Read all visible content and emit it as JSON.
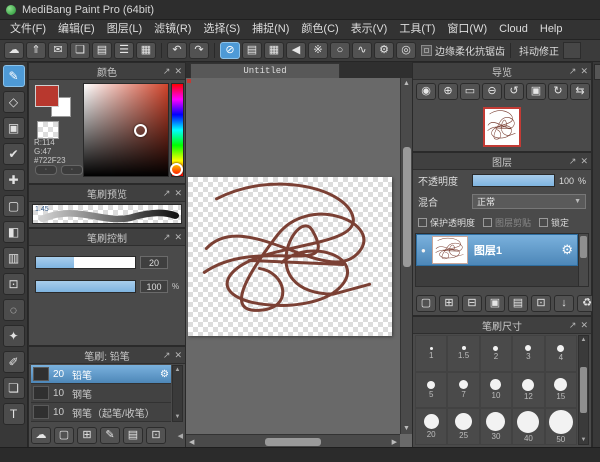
{
  "window": {
    "title": "MediBang Paint Pro (64bit)"
  },
  "menu": {
    "items": [
      "文件(F)",
      "编辑(E)",
      "图层(L)",
      "滤镜(R)",
      "选择(S)",
      "捕捉(N)",
      "颜色(C)",
      "表示(V)",
      "工具(T)",
      "窗口(W)",
      "Cloud",
      "Help"
    ]
  },
  "toolbar": {
    "file_icons": [
      {
        "name": "cloud-icon",
        "glyph": "☁"
      },
      {
        "name": "publish-icon",
        "glyph": "⇑"
      },
      {
        "name": "message-icon",
        "glyph": "✉"
      },
      {
        "name": "comment-icon",
        "glyph": "❏"
      },
      {
        "name": "document-icon",
        "glyph": "▤"
      },
      {
        "name": "list-icon",
        "glyph": "☰"
      },
      {
        "name": "grid-icon",
        "glyph": "▦"
      }
    ],
    "history_icons": [
      {
        "name": "undo-icon",
        "glyph": "↶"
      },
      {
        "name": "redo-icon",
        "glyph": "↷"
      }
    ],
    "draw_icons": [
      {
        "name": "freehand-mode-icon",
        "glyph": "⊘",
        "cls": "active"
      },
      {
        "name": "parallel-lines-snap-icon",
        "glyph": "▤"
      },
      {
        "name": "grid-snap-icon",
        "glyph": "▦"
      },
      {
        "name": "vanishing-point-snap-icon",
        "glyph": "◀"
      },
      {
        "name": "cross-snap-icon",
        "glyph": "※"
      },
      {
        "name": "ellipse-snap-icon",
        "glyph": "○"
      },
      {
        "name": "curve-snap-icon",
        "glyph": "∿"
      },
      {
        "name": "radial-snap-icon",
        "glyph": "⚙"
      },
      {
        "name": "concentric-snap-icon",
        "glyph": "◎"
      }
    ],
    "edge_smooth_label": "边缘柔化抗锯齿",
    "stabilizer_label": "抖动修正"
  },
  "tools": [
    {
      "name": "brush-tool",
      "glyph": "✎",
      "cls": "active"
    },
    {
      "name": "eraser-tool",
      "glyph": "◇"
    },
    {
      "name": "shape-brush-tool",
      "glyph": "▣"
    },
    {
      "name": "dot-tool",
      "glyph": "✔"
    },
    {
      "name": "move-tool",
      "glyph": "✚"
    },
    {
      "name": "select-move-tool",
      "glyph": "▢"
    },
    {
      "name": "bucket-tool",
      "glyph": "◧"
    },
    {
      "name": "gradient-tool",
      "glyph": "▥"
    },
    {
      "name": "select-rect-tool",
      "glyph": "⊡"
    },
    {
      "name": "lasso-tool",
      "glyph": "◌"
    },
    {
      "name": "magic-wand-tool",
      "glyph": "✦"
    },
    {
      "name": "select-pen-tool",
      "glyph": "✐"
    },
    {
      "name": "select-eraser-tool",
      "glyph": "❏"
    },
    {
      "name": "text-tool",
      "glyph": "T"
    }
  ],
  "color_panel": {
    "title": "颜色",
    "r_label": "R:114",
    "g_label": "G:47",
    "hex_label": "#722F23"
  },
  "brush_preview_panel": {
    "title": "笔刷预览",
    "zoom": "1.45"
  },
  "brush_control_panel": {
    "title": "笔刷控制",
    "size_value": "20",
    "opacity_value": "100",
    "opacity_unit": "%"
  },
  "brush_panel": {
    "title": "笔刷: 铅笔",
    "items": [
      {
        "size": "20",
        "name": "铅笔",
        "cls": "selected"
      },
      {
        "size": "10",
        "name": "钢笔"
      },
      {
        "size": "10",
        "name": "钢笔（起笔/收笔）"
      }
    ],
    "footer_icons": [
      {
        "name": "brush-cloud-upload-icon",
        "glyph": "☁"
      },
      {
        "name": "brush-new-icon",
        "glyph": "▢"
      },
      {
        "name": "brush-add-menu-icon",
        "glyph": "⊞"
      },
      {
        "name": "brush-edit-icon",
        "glyph": "✎"
      },
      {
        "name": "brush-folder-icon",
        "glyph": "▤"
      },
      {
        "name": "brush-duplicate-icon",
        "glyph": "⊡"
      }
    ]
  },
  "canvas": {
    "tab": "Untitled"
  },
  "navigator_panel": {
    "title": "导览",
    "buttons": [
      {
        "name": "zoom-reset-icon",
        "glyph": "◉"
      },
      {
        "name": "zoom-in-icon",
        "glyph": "⊕"
      },
      {
        "name": "fit-screen-icon",
        "glyph": "▭"
      },
      {
        "name": "zoom-out-icon",
        "glyph": "⊖"
      },
      {
        "name": "rotate-left-icon",
        "glyph": "↺"
      },
      {
        "name": "fit-view-icon",
        "glyph": "▣"
      },
      {
        "name": "rotate-right-icon",
        "glyph": "↻"
      },
      {
        "name": "flip-horizontal-icon",
        "glyph": "⇆"
      }
    ]
  },
  "layers_panel": {
    "title": "图层",
    "opacity_label": "不透明度",
    "opacity_value": "100",
    "opacity_unit": "%",
    "blend_label": "混合",
    "blend_value": "正常",
    "checkboxes": [
      {
        "label": "保护透明度"
      },
      {
        "label": "图层剪贴",
        "cls": "dim"
      },
      {
        "label": "锁定"
      }
    ],
    "layer_name": "图层1",
    "action_icons": [
      {
        "name": "new-layer-icon",
        "glyph": "▢"
      },
      {
        "name": "new-8bit-layer-icon",
        "glyph": "⊞"
      },
      {
        "name": "new-1bit-layer-icon",
        "glyph": "⊟"
      },
      {
        "name": "add-layer-menu-icon",
        "glyph": "▣"
      },
      {
        "name": "layer-folder-icon",
        "glyph": "▤"
      },
      {
        "name": "duplicate-layer-icon",
        "glyph": "⊡"
      },
      {
        "name": "merge-layer-icon",
        "glyph": "↓"
      },
      {
        "name": "delete-layer-icon",
        "glyph": "♻"
      }
    ]
  },
  "brush_size_panel": {
    "title": "笔刷尺寸",
    "sizes": [
      "1",
      "1.5",
      "2",
      "3",
      "4",
      "5",
      "7",
      "10",
      "12",
      "15",
      "20",
      "25",
      "30",
      "40",
      "50"
    ]
  },
  "icons": {
    "gear": "⚙",
    "dot": "●",
    "up": "▲",
    "down": "▼",
    "left": "◀",
    "right": "▶",
    "popout": "↗",
    "close": "✕",
    "caret": "▼",
    "pill": "◦"
  },
  "colors": {
    "accent": "#4e9ad6",
    "selected_color": "#722F23",
    "stroke": "#7b4034"
  }
}
